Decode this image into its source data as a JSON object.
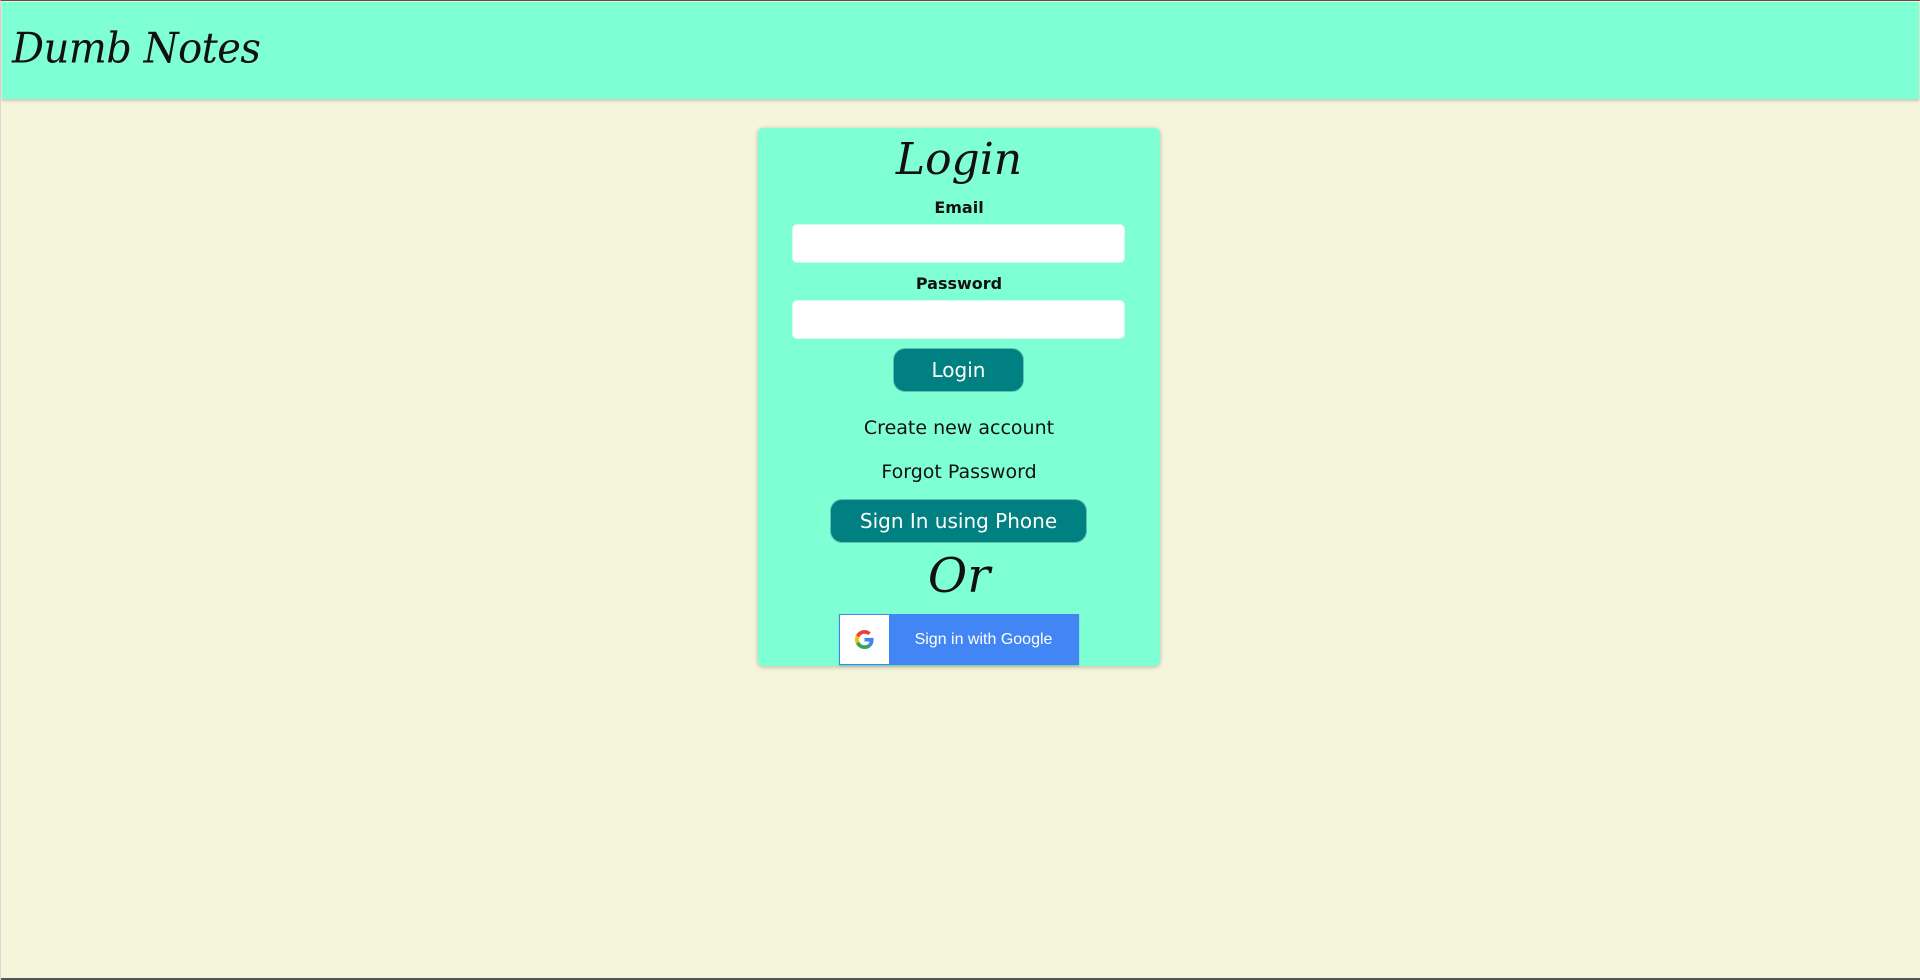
{
  "navbar": {
    "brand": "Dumb Notes"
  },
  "login_card": {
    "title": "Login",
    "email_label": "Email",
    "email_value": "",
    "password_label": "Password",
    "password_value": "",
    "login_button": "Login",
    "create_account_link": "Create new account",
    "forgot_password_link": "Forgot Password",
    "phone_button": "Sign In using Phone",
    "or_text": "Or",
    "google_button": "Sign in with Google"
  },
  "colors": {
    "navbar_bg": "#7fffd4",
    "page_bg": "#f5f5dc",
    "card_bg": "#7fffd4",
    "button_teal": "#008080",
    "google_blue": "#4285f4"
  },
  "icons": {
    "google": "google-g-icon"
  }
}
